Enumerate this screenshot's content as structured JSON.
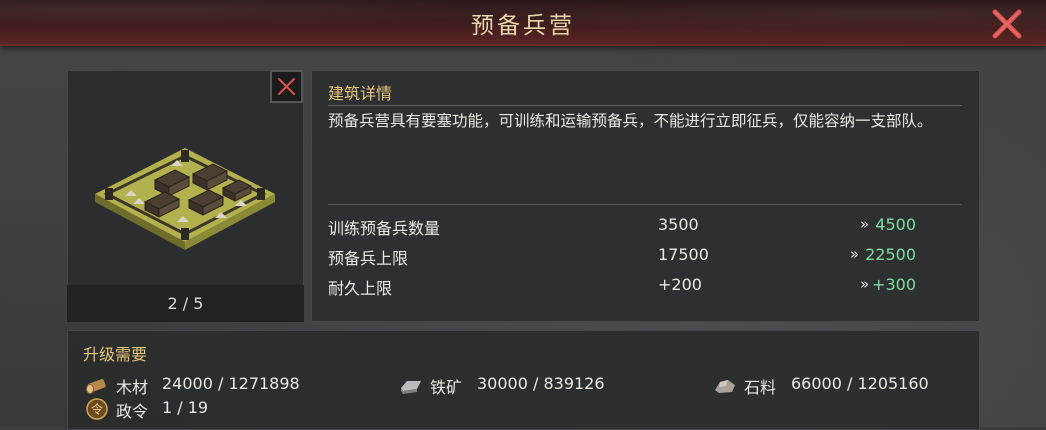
{
  "window": {
    "title": "预备兵营",
    "close_icon": "close-x-icon"
  },
  "building_image": {
    "page_indicator": "2 / 5",
    "close_icon": "close-x-icon"
  },
  "details": {
    "section_title": "建筑详情",
    "description": "预备兵营具有要塞功能，可训练和运输预备兵，不能进行立即征兵，仅能容纳一支部队。",
    "stats": [
      {
        "label": "训练预备兵数量",
        "current": "3500",
        "arrow": "»",
        "next": "4500"
      },
      {
        "label": "预备兵上限",
        "current": "17500",
        "arrow": "»",
        "next": "22500"
      },
      {
        "label": "耐久上限",
        "current": "+200",
        "arrow": "»",
        "next": "+300"
      }
    ]
  },
  "requirements": {
    "section_title": "升级需要",
    "resources": [
      {
        "icon": "wood-log-icon",
        "name": "木材",
        "value": "24000 / 1271898"
      },
      {
        "icon": "iron-ore-icon",
        "name": "铁矿",
        "value": "30000 / 839126"
      },
      {
        "icon": "stone-icon",
        "name": "石料",
        "value": "66000 / 1205160"
      },
      {
        "icon": "decree-token-icon",
        "name": "政令",
        "value": "1 / 19"
      }
    ]
  },
  "colors": {
    "accent_gold": "#e7c77a",
    "upgrade_green": "#7ddca0",
    "close_red": "#d9524f"
  }
}
